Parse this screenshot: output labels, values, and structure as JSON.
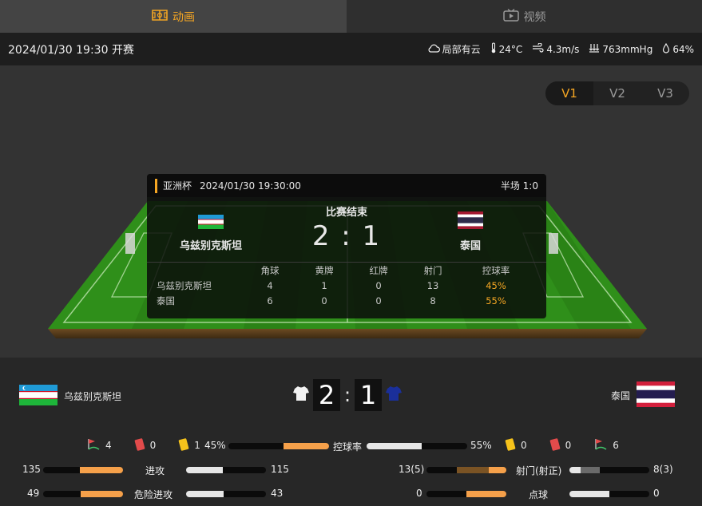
{
  "tabs": {
    "animation_label": "动画",
    "video_label": "视频"
  },
  "info": {
    "kickoff": "2024/01/30 19:30 开赛",
    "weather": "局部有云",
    "temperature": "24°C",
    "wind": "4.3m/s",
    "pressure": "763mmHg",
    "humidity": "64%"
  },
  "versions": [
    "V1",
    "V2",
    "V3"
  ],
  "panel": {
    "league": "亚洲杯",
    "datetime": "2024/01/30 19:30:00",
    "half": "半场 1:0",
    "status": "比赛结束",
    "home_score": "2",
    "separator": ":",
    "away_score": "1",
    "home_name": "乌兹别克斯坦",
    "away_name": "泰国",
    "headers": [
      "角球",
      "黄牌",
      "红牌",
      "射门",
      "控球率"
    ],
    "rows": [
      {
        "team": "乌兹别克斯坦",
        "values": [
          "4",
          "1",
          "0",
          "13"
        ],
        "possession": "45%"
      },
      {
        "team": "泰国",
        "values": [
          "6",
          "0",
          "0",
          "8"
        ],
        "possession": "55%"
      }
    ]
  },
  "bottom": {
    "home_name": "乌兹别克斯坦",
    "away_name": "泰国",
    "home_score": "2",
    "away_score": "1",
    "home_corners": "4",
    "home_red": "0",
    "home_yellow": "1",
    "away_yellow": "0",
    "away_red": "0",
    "away_corners": "6",
    "possession_label": "控球率",
    "home_possession": "45%",
    "away_possession": "55%",
    "possession_home_fraction": 0.45,
    "attack_label": "进攻",
    "home_attack": "135",
    "away_attack": "115",
    "danger_label": "危险进攻",
    "home_danger": "49",
    "away_danger": "43",
    "shots_label": "射门(射正)",
    "home_shots": "13(5)",
    "away_shots": "8(3)",
    "penalty_label": "点球",
    "home_penalty": "0",
    "away_penalty": "0"
  },
  "colors": {
    "accent": "#f5a623",
    "home_bar": "#f5a04a",
    "away_bar": "#e6e6e6",
    "pitch": "#2f8f1a"
  }
}
